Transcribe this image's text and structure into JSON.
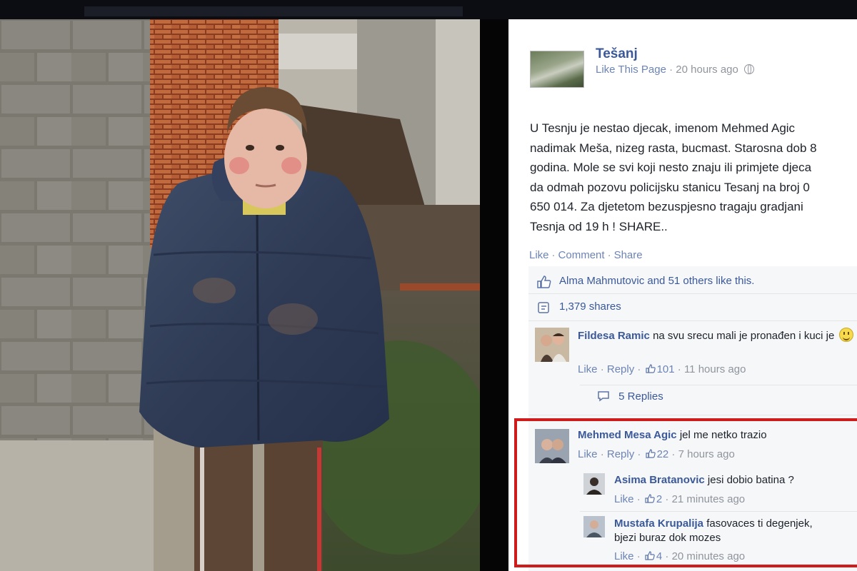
{
  "page": {
    "name": "Tešanj",
    "like_label": "Like This Page",
    "time": "20 hours ago",
    "privacy_icon": "globe-icon"
  },
  "post": {
    "text": "U Tesnju je nestao djecak, imenom Mehmed Agic\nnadimak Meša, nizeg rasta, bucmast. Starosna dob 8\ngodina. Mole se svi koji nesto znaju ili primjete djeca\nda odmah pozovu policijsku stanicu Tesanj na broj 0\n650 014. Za djetetom bezuspjesno tragaju gradjani\nTesnja od 19 h ! SHARE..",
    "actions": {
      "like": "Like",
      "comment": "Comment",
      "share": "Share"
    },
    "likes_summary": "Alma Mahmutovic and 51 others like this.",
    "shares": "1,379 shares"
  },
  "comments": [
    {
      "author": "Fildesa Ramic",
      "text": "na svu srecu mali je pronađen i kuci je",
      "like": "Like",
      "reply": "Reply",
      "likes": "101",
      "time": "11 hours ago",
      "replies_label": "5 Replies"
    },
    {
      "author": "Mehmed Mesa Agic",
      "text": "jel me netko trazio",
      "like": "Like",
      "reply": "Reply",
      "likes": "22",
      "time": "7 hours ago",
      "replies": [
        {
          "author": "Asima Bratanovic",
          "text": "jesi dobio batina ?",
          "like": "Like",
          "likes": "2",
          "time": "21 minutes ago"
        },
        {
          "author": "Mustafa Krupalija",
          "text_line1": "fasovaces ti degenjek,",
          "text_line2": "bjezi buraz dok mozes",
          "like": "Like",
          "likes": "4",
          "time": "20 minutes ago"
        }
      ]
    }
  ],
  "colors": {
    "link": "#3b5998",
    "meta": "#90949c",
    "highlight": "#d01b1b"
  }
}
